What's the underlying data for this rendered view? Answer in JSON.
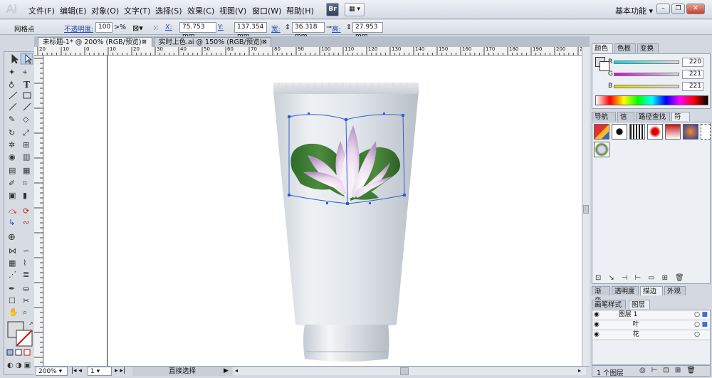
{
  "app": {
    "logo": "Ai",
    "workspace": "基本功能"
  },
  "menu": [
    "文件(F)",
    "编辑(E)",
    "对象(O)",
    "文字(T)",
    "选择(S)",
    "效果(C)",
    "视图(V)",
    "窗口(W)",
    "帮助(H)"
  ],
  "bridge_label": "Br",
  "control": {
    "selection_type": "网格点",
    "opacity_label": "不透明度:",
    "opacity_value": "100",
    "opacity_unit": "%",
    "x_label": "X:",
    "x_value": "75.753 mm",
    "y_label": "Y:",
    "y_value": "137.354 mm",
    "w_label": "宽:",
    "w_value": "36.318 mm",
    "h_label": "高:",
    "h_value": "27.953 mm"
  },
  "tabs": [
    {
      "label": "未标题-1* @ 200% (RGB/预览)",
      "active": true
    },
    {
      "label": "实时上色.ai @ 150% (RGB/预览)",
      "active": false
    }
  ],
  "ruler_h": [
    "20",
    "10",
    "0",
    "10",
    "20",
    "30",
    "40",
    "50",
    "60",
    "70",
    "80",
    "90",
    "100",
    "110",
    "120",
    "130",
    "140",
    "150",
    "160",
    "170",
    "180",
    "190",
    "200",
    "210"
  ],
  "status": {
    "zoom": "200%",
    "page": "1",
    "tool": "直接选择"
  },
  "color_panel": {
    "tabs": [
      "颜色",
      "色板",
      "变换"
    ],
    "r_label": "R",
    "r_value": "220",
    "g_label": "G",
    "g_value": "221",
    "b_label": "B",
    "b_value": "221"
  },
  "symbols_panel": {
    "tabs": [
      "导航器",
      "信息",
      "路径查找器",
      "符号"
    ]
  },
  "stroke_panel": {
    "tabs": [
      "渐变",
      "透明度",
      "描边",
      "外观"
    ]
  },
  "layers_panel": {
    "tabs": [
      "画笔样式",
      "图层"
    ],
    "layers": [
      {
        "name": "图层 1"
      },
      {
        "name": "叶"
      },
      {
        "name": "花"
      }
    ],
    "count": "1 个图层"
  },
  "colors": {
    "accent": "#3a6fd8",
    "fill": "#dcdddd"
  }
}
